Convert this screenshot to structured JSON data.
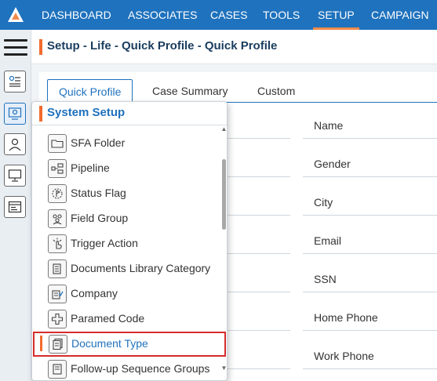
{
  "nav": {
    "items": [
      {
        "label": "DASHBOARD",
        "active": false
      },
      {
        "label": "ASSOCIATES",
        "active": false
      },
      {
        "label": "CASES",
        "active": false
      },
      {
        "label": "TOOLS",
        "active": false
      },
      {
        "label": "SETUP",
        "active": true
      },
      {
        "label": "CAMPAIGN",
        "active": false
      }
    ]
  },
  "header": {
    "title": "Setup - Life - Quick Profile - Quick Profile"
  },
  "tabs": [
    {
      "label": "Quick Profile",
      "active": true
    },
    {
      "label": "Case Summary",
      "active": false
    },
    {
      "label": "Custom",
      "active": false
    }
  ],
  "form": {
    "fields": [
      "Name",
      "Gender",
      "City",
      "Email",
      "SSN",
      "Home Phone",
      "Work Phone"
    ]
  },
  "system_setup": {
    "title": "System Setup",
    "items": [
      {
        "label": "SFA Folder",
        "icon": "folder-icon"
      },
      {
        "label": "Pipeline",
        "icon": "pipeline-icon"
      },
      {
        "label": "Status Flag",
        "icon": "status-flag-icon"
      },
      {
        "label": "Field Group",
        "icon": "field-group-icon"
      },
      {
        "label": "Trigger Action",
        "icon": "trigger-action-icon"
      },
      {
        "label": "Documents Library Category",
        "icon": "documents-library-icon"
      },
      {
        "label": "Company",
        "icon": "company-icon"
      },
      {
        "label": "Paramed Code",
        "icon": "paramed-code-icon"
      },
      {
        "label": "Document Type",
        "icon": "document-type-icon",
        "selected": true
      },
      {
        "label": "Follow-up Sequence Groups",
        "icon": "follow-up-icon"
      }
    ]
  },
  "colors": {
    "brand": "#1f72bd",
    "accent": "#f26b2f",
    "highlight_border": "#d62c2c"
  }
}
